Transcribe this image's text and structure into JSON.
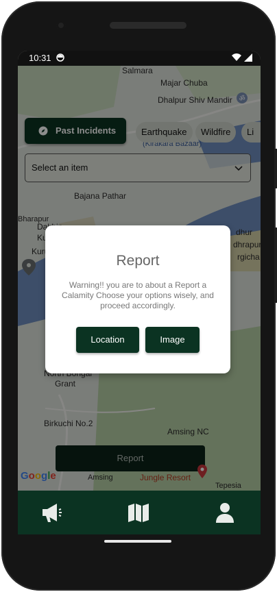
{
  "status_bar": {
    "time": "10:31"
  },
  "map": {
    "labels": [
      "Salmara",
      "Majar Chuba",
      "Dhalpur Shiv Mandir",
      "(Kirakara Bazaar)",
      "Bajana Pathar",
      "Dakhin",
      "Kuru",
      "Kuru",
      "dhur",
      "North Bongal",
      "Grant",
      "Birkuchi No.2",
      "Amsing NC",
      "Amsing",
      "Tepesia",
      "dhrapur",
      "rgicha",
      "Bharapur"
    ],
    "google_logo": "Google",
    "poi_jungle_resort": "Jungle Resort"
  },
  "chips": {
    "past_incidents": "Past Incidents",
    "filters": [
      "Earthquake",
      "Wildfire",
      "Li"
    ]
  },
  "dropdown": {
    "placeholder": "Select an item"
  },
  "dialog": {
    "title": "Report",
    "message": "Warning!! you are to about a Report a Calamity Choose your options wisely, and proceed accordingly.",
    "location_button": "Location",
    "image_button": "Image"
  },
  "report_button": "Report",
  "bottom_nav": {
    "items": [
      "megaphone-icon",
      "map-icon",
      "person-icon"
    ]
  },
  "colors": {
    "primary_dark_green": "#0b3322",
    "map_water": "#6f8fc0",
    "map_land": "#dfe3dc"
  }
}
